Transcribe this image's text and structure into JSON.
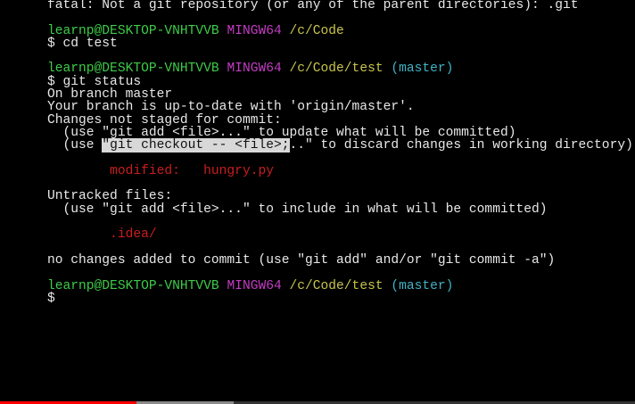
{
  "colors": {
    "green": "#3dcc48",
    "magenta": "#c43cc4",
    "yellow": "#c8c44a",
    "cyan": "#3fb2c4",
    "red": "#c81e1e",
    "selection": "#d8d8d8"
  },
  "terminal": {
    "lines": [
      [
        {
          "t": "fatal: Not a git repository (or any of the parent directories): .git",
          "c": "white"
        }
      ],
      [],
      [
        {
          "t": "learnp@DESKTOP-VNHTVVB ",
          "c": "green"
        },
        {
          "t": "MINGW64 ",
          "c": "magenta"
        },
        {
          "t": "/c/Code",
          "c": "yellow"
        }
      ],
      [
        {
          "t": "$ cd test",
          "c": "white"
        }
      ],
      [],
      [
        {
          "t": "learnp@DESKTOP-VNHTVVB ",
          "c": "green"
        },
        {
          "t": "MINGW64 ",
          "c": "magenta"
        },
        {
          "t": "/c/Code/test ",
          "c": "yellow"
        },
        {
          "t": "(master)",
          "c": "cyan"
        }
      ],
      [
        {
          "t": "$ git status",
          "c": "white"
        }
      ],
      [
        {
          "t": "On branch master",
          "c": "white"
        }
      ],
      [
        {
          "t": "Your branch is up-to-date with 'origin/master'.",
          "c": "white"
        }
      ],
      [
        {
          "t": "Changes not staged for commit:",
          "c": "white"
        }
      ],
      [
        {
          "t": "  (use \"git add <file>...\" to update what will be committed)",
          "c": "white"
        }
      ],
      [
        {
          "t": "  (use ",
          "c": "white"
        },
        {
          "t": "\"git checkout -- <file>;",
          "c": "sel"
        },
        {
          "t": "..\" to discard changes in working directory)",
          "c": "white"
        }
      ],
      [],
      [
        {
          "t": "        modified:   hungry.py",
          "c": "red"
        }
      ],
      [],
      [
        {
          "t": "Untracked files:",
          "c": "white"
        }
      ],
      [
        {
          "t": "  (use \"git add <file>...\" to include in what will be committed)",
          "c": "white"
        }
      ],
      [],
      [
        {
          "t": "        .idea/",
          "c": "red"
        }
      ],
      [],
      [
        {
          "t": "no changes added to commit (use \"git add\" and/or \"git commit -a\")",
          "c": "white"
        }
      ],
      [],
      [
        {
          "t": "learnp@DESKTOP-VNHTVVB ",
          "c": "green"
        },
        {
          "t": "MINGW64 ",
          "c": "magenta"
        },
        {
          "t": "/c/Code/test ",
          "c": "yellow"
        },
        {
          "t": "(master)",
          "c": "cyan"
        }
      ],
      [
        {
          "t": "$",
          "c": "white"
        }
      ]
    ]
  },
  "video_progress": {
    "played_percent": 21.5,
    "buffered_percent": 36.8
  }
}
